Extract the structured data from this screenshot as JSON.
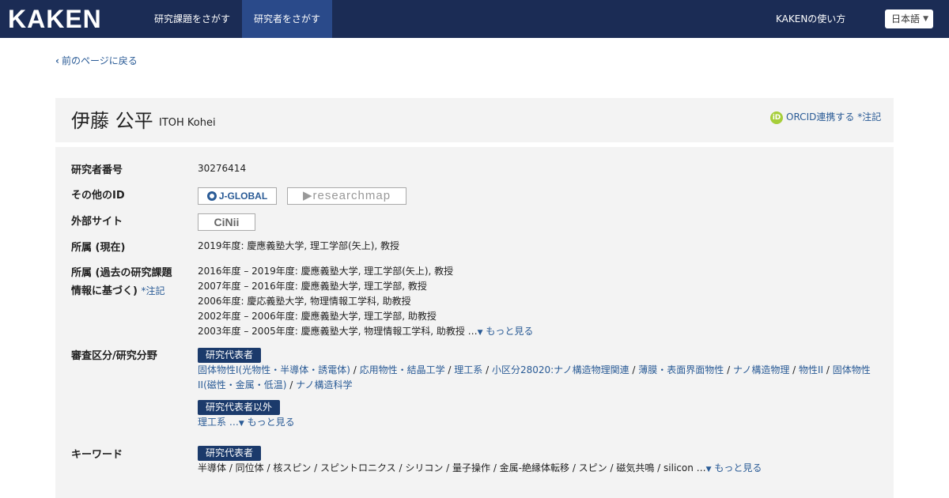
{
  "header": {
    "logo": "KAKEN",
    "nav": [
      "研究課題をさがす",
      "研究者をさがす"
    ],
    "help": "KAKENの使い方",
    "language": "日本語"
  },
  "back_link": "前のページに戻る",
  "researcher": {
    "name_ja": "伊藤 公平",
    "name_en": "ITOH Kohei",
    "orcid_link": "ORCID連携する",
    "orcid_note": "*注記"
  },
  "labels": {
    "researcher_number": "研究者番号",
    "other_id": "その他のID",
    "external_sites": "外部サイト",
    "affiliation_current": "所属 (現在)",
    "affiliation_past_line1": "所属 (過去の研究課題",
    "affiliation_past_line2": "情報に基づく)",
    "affiliation_past_note": "*注記",
    "review_field": "審査区分/研究分野",
    "keywords": "キーワード"
  },
  "values": {
    "researcher_number": "30276414",
    "jglobal": "J-GLOBAL",
    "researchmap": "researchmap",
    "cinii": "CiNii",
    "affiliation_current": "2019年度: 慶應義塾大学, 理工学部(矢上), 教授",
    "affiliation_past": [
      "2016年度 – 2019年度: 慶應義塾大学, 理工学部(矢上), 教授",
      "2007年度 – 2016年度: 慶應義塾大学, 理工学部, 教授",
      "2006年度: 慶応義塾大学, 物理情報工学科, 助教授",
      "2002年度 – 2006年度: 慶應義塾大学, 理工学部, 助教授",
      "2003年度 – 2005年度: 慶應義塾大学, 物理情報工学科, 助教授 …"
    ],
    "more": "もっと見る",
    "tag_pi": "研究代表者",
    "tag_non_pi": "研究代表者以外",
    "fields_pi": [
      "固体物性I(光物性・半導体・誘電体)",
      "応用物性・結晶工学",
      "理工系",
      "小区分28020:ナノ構造物理関連",
      "薄膜・表面界面物性",
      "ナノ構造物理",
      "物性II",
      "固体物性II(磁性・金属・低温)",
      "ナノ構造科学"
    ],
    "fields_non_pi": "理工系 …",
    "keywords_pi": "半導体 / 同位体 / 核スピン / スピントロニクス / シリコン / 量子操作 / 金属-絶縁体転移 / スピン / 磁気共鳴 / silicon …"
  }
}
